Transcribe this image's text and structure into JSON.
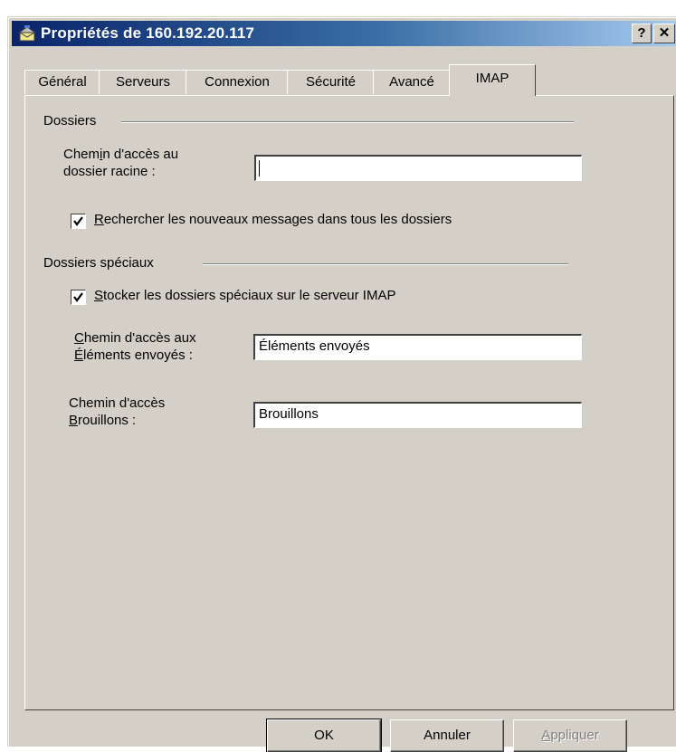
{
  "window": {
    "title": "Propriétés de 160.192.20.117",
    "help_label": "?",
    "close_label": "✕"
  },
  "tabs": [
    {
      "label": "Général",
      "active": false
    },
    {
      "label": "Serveurs",
      "active": false
    },
    {
      "label": "Connexion",
      "active": false
    },
    {
      "label": "Sécurité",
      "active": false
    },
    {
      "label": "Avancé",
      "active": false
    },
    {
      "label": "IMAP",
      "active": true
    }
  ],
  "dossiers": {
    "group_label": "Dossiers",
    "root_path_label_pre": "Chem",
    "root_path_label_u": "i",
    "root_path_label_post": "n d'accès au",
    "root_path_label_line2": "dossier racine :",
    "root_path_value": "",
    "check_all_prefix": "R",
    "check_all_rest": "echercher les nouveaux messages dans tous les dossiers",
    "check_all_checked": true
  },
  "special": {
    "group_label": "Dossiers spéciaux",
    "store_prefix": "S",
    "store_rest": "tocker les dossiers spéciaux sur le serveur IMAP",
    "store_checked": true,
    "sent_label_line1_u": "C",
    "sent_label_line1_rest": "hemin d'accès aux",
    "sent_label_line2_u": "É",
    "sent_label_line2_rest": "léments envoyés :",
    "sent_value": "Éléments envoyés",
    "drafts_label_line1": "Chemin d'accès",
    "drafts_label_line2_u": "B",
    "drafts_label_line2_rest": "rouillons :",
    "drafts_value": "Brouillons"
  },
  "buttons": {
    "ok": "OK",
    "cancel": "Annuler",
    "apply_u": "A",
    "apply_rest": "ppliquer",
    "apply_enabled": false
  }
}
